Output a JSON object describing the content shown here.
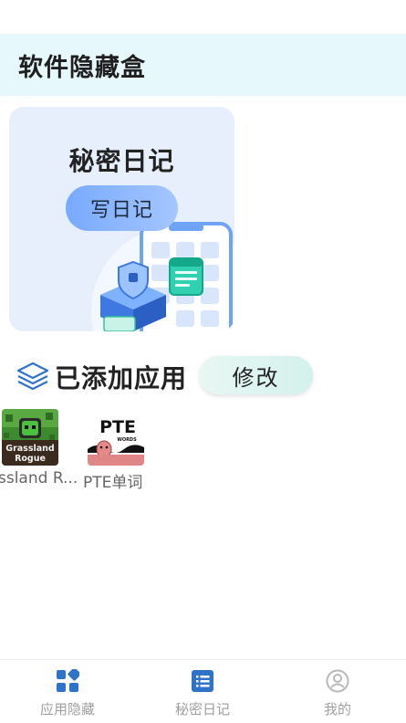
{
  "header": {
    "title": "软件隐藏盒"
  },
  "diary_card": {
    "title": "秘密日记",
    "button_label": "写日记"
  },
  "apps_section": {
    "title": "已添加应用",
    "edit_label": "修改",
    "apps": [
      {
        "label": "ssland R...",
        "icon": "grassland-rogue-app-icon",
        "icon_text_line1": "Grassland",
        "icon_text_line2": "Rogue"
      },
      {
        "label": "PTE单词",
        "icon": "pte-words-app-icon",
        "icon_text_line1": "PTE",
        "icon_text_line2": "WORDS"
      }
    ]
  },
  "tabbar": {
    "tabs": [
      {
        "label": "应用隐藏",
        "icon": "apps-grid-icon",
        "active": true
      },
      {
        "label": "秘密日记",
        "icon": "list-icon",
        "active": false
      },
      {
        "label": "我的",
        "icon": "user-profile-icon",
        "active": false
      }
    ]
  },
  "colors": {
    "header_bg": "#e6f8fb",
    "card_bg": "#e7effd",
    "accent_blue": "#2f73c9",
    "button_gradient_start": "#78a9ff",
    "edit_button_bg": "#d4f1ec",
    "tab_inactive": "#a0a0a0"
  }
}
